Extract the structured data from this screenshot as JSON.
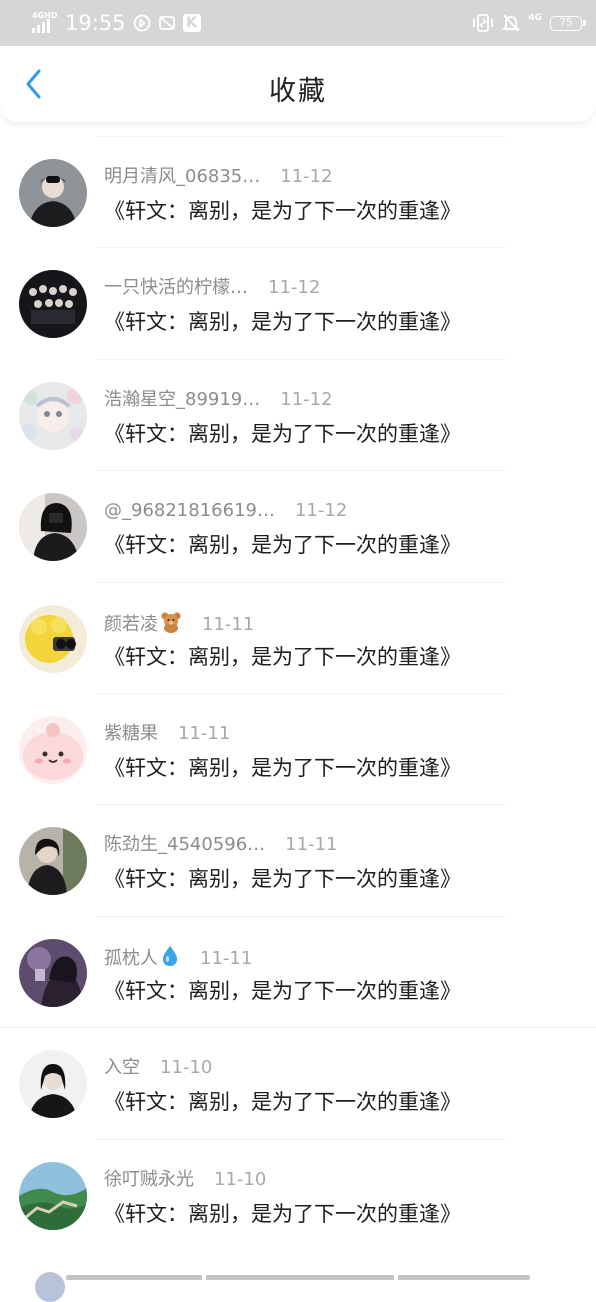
{
  "status_bar": {
    "network": "4GHD",
    "time": "19:55",
    "k_label": "K",
    "net_right": "4G",
    "battery": "75"
  },
  "header": {
    "title": "收藏",
    "back_icon": "chevron-left-icon"
  },
  "colors": {
    "accent": "#2f9be8",
    "status_bar_bg": "#d6d6d6",
    "meta_text": "#8c8c8c"
  },
  "items": [
    {
      "user": "明月清风_06835…",
      "date": "11-12",
      "content": "《轩文：离别，是为了下一次的重逢》"
    },
    {
      "user": "一只快活的柠檬…",
      "date": "11-12",
      "content": "《轩文：离别，是为了下一次的重逢》"
    },
    {
      "user": "浩瀚星空_89919…",
      "date": "11-12",
      "content": "《轩文：离别，是为了下一次的重逢》"
    },
    {
      "user": "@_96821816619…",
      "date": "11-12",
      "content": "《轩文：离别，是为了下一次的重逢》"
    },
    {
      "user": "颜若凌",
      "emoji": "bear-icon",
      "date": "11-11",
      "content": "《轩文：离别，是为了下一次的重逢》"
    },
    {
      "user": "紫糖果",
      "date": "11-11",
      "content": "《轩文：离别，是为了下一次的重逢》"
    },
    {
      "user": "陈劲生_4540596…",
      "date": "11-11",
      "content": "《轩文：离别，是为了下一次的重逢》"
    },
    {
      "user": "孤枕人",
      "emoji": "droplet-icon",
      "date": "11-11",
      "content": "《轩文：离别，是为了下一次的重逢》"
    },
    {
      "user": "入空",
      "date": "11-10",
      "content": "《轩文：离别，是为了下一次的重逢》"
    },
    {
      "user": "徐叮贼永光",
      "date": "11-10",
      "content": "《轩文：离别，是为了下一次的重逢》"
    }
  ]
}
